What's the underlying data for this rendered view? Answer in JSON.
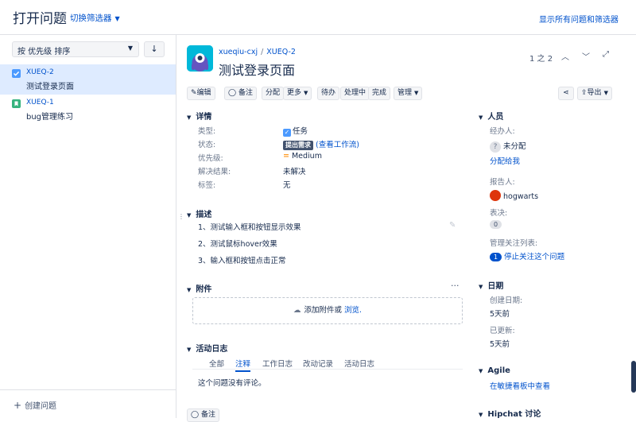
{
  "header": {
    "title": "打开问题",
    "filter_switch": "切换筛选器",
    "show_all": "显示所有问题和筛选器"
  },
  "left": {
    "sort_label": "按 优先级 排序",
    "issues": [
      {
        "key": "XUEQ-2",
        "summary": "测试登录页面",
        "type": "task",
        "active": true
      },
      {
        "key": "XUEQ-1",
        "summary": "bug管理练习",
        "type": "story",
        "active": false
      }
    ],
    "create_issue": "创建问题"
  },
  "issue": {
    "project": "xueqiu-cxj",
    "key": "XUEQ-2",
    "summary": "测试登录页面",
    "pager": "1 之 2"
  },
  "toolbar": {
    "edit": "编辑",
    "comment": "备注",
    "assign": "分配",
    "more": "更多",
    "todo": "待办",
    "in_progress": "处理中",
    "done": "完成",
    "admin": "管理",
    "export": "导出"
  },
  "details": {
    "heading": "详情",
    "type_label": "类型:",
    "type_value": "任务",
    "status_label": "状态:",
    "status_value": "提出需求",
    "status_link": "(查看工作流)",
    "priority_label": "优先级:",
    "priority_value": "Medium",
    "resolution_label": "解决结果:",
    "resolution_value": "未解决",
    "labels_label": "标签:",
    "labels_value": "无"
  },
  "description": {
    "heading": "描述",
    "lines": [
      "1、测试输入框和按钮显示效果",
      "2、测试鼠标hover效果",
      "3、输入框和按钮点击正常"
    ]
  },
  "attachments": {
    "heading": "附件",
    "add_text": "添加附件或",
    "browse": "浏览."
  },
  "activity": {
    "heading": "活动日志",
    "tabs": [
      "全部",
      "注释",
      "工作日志",
      "改动记录",
      "活动日志"
    ],
    "empty": "这个问题没有评论。",
    "comment_btn": "备注"
  },
  "people": {
    "heading": "人员",
    "assignee_label": "经办人:",
    "assignee_value": "未分配",
    "assign_to_me": "分配给我",
    "reporter_label": "报告人:",
    "reporter_value": "hogwarts",
    "votes_label": "表决:",
    "votes_value": "0",
    "watchers_label": "管理关注列表:",
    "watchers_value": "1",
    "stop_watching": "停止关注这个问题"
  },
  "dates": {
    "heading": "日期",
    "created_label": "创建日期:",
    "created_value": "5天前",
    "updated_label": "已更新:",
    "updated_value": "5天前"
  },
  "agile": {
    "heading": "Agile",
    "link": "在敏捷看板中查看"
  },
  "hipchat": {
    "heading": "Hipchat 讨论"
  }
}
